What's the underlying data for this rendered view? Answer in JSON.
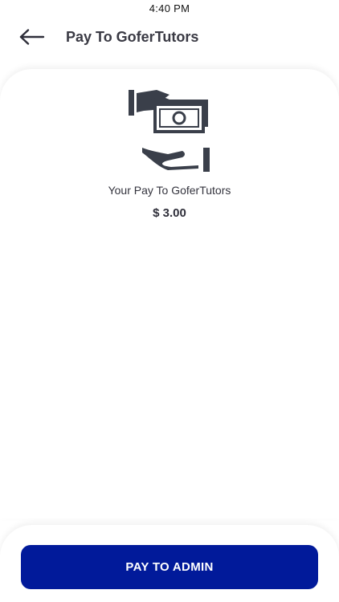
{
  "status_bar": {
    "time": "4:40 PM"
  },
  "header": {
    "back_icon": "arrow-left-icon",
    "title": "Pay To GoferTutors"
  },
  "main": {
    "illustration_icon": "hand-giving-money-icon",
    "pay_label": "Your Pay To GoferTutors",
    "amount": "$ 3.00"
  },
  "footer": {
    "button_label": "PAY TO ADMIN"
  },
  "colors": {
    "primary_button": "#011a9a",
    "icon": "#3a3f4a",
    "text": "#2f2f3a"
  }
}
